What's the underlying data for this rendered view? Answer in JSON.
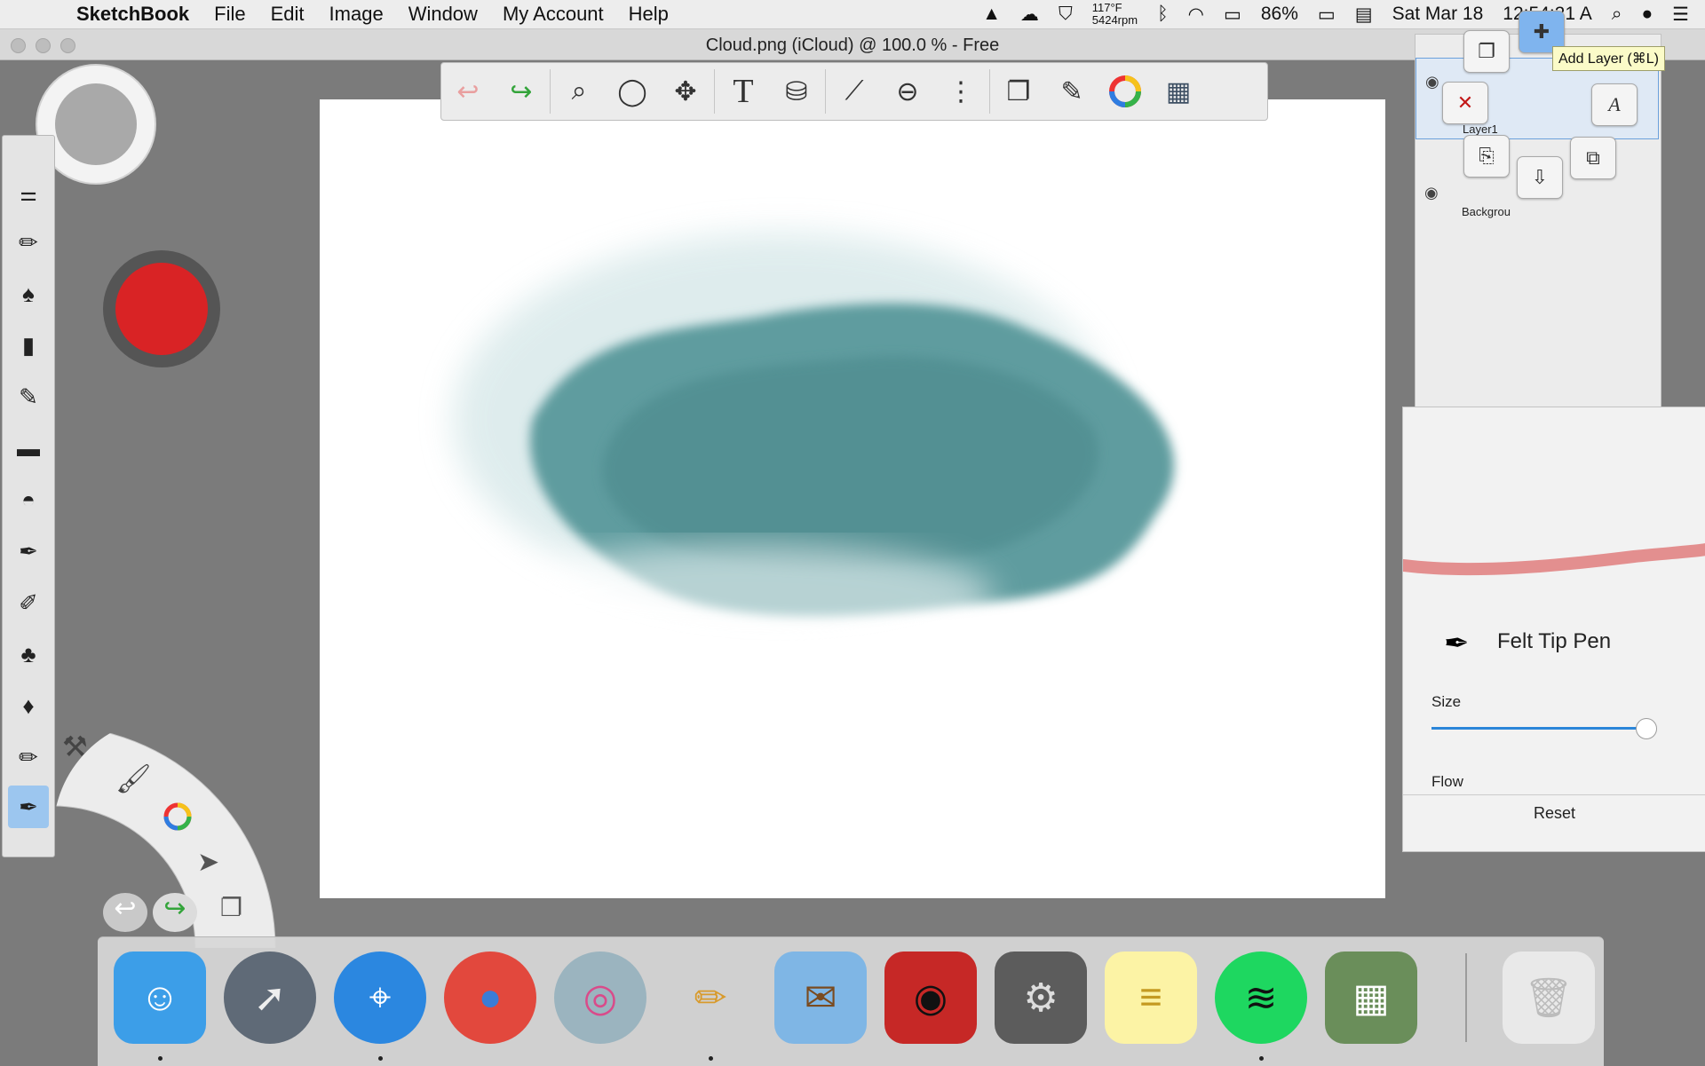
{
  "menubar": {
    "app_name": "SketchBook",
    "items": [
      "File",
      "Edit",
      "Image",
      "Window",
      "My Account",
      "Help"
    ],
    "status": {
      "temp": "117°F",
      "rpm": "5424rpm",
      "battery": "86%",
      "date": "Sat Mar 18",
      "time": "12:54:21 A"
    }
  },
  "window": {
    "title": "Cloud.png (iCloud) @ 100.0 % - Free"
  },
  "toolbar": {
    "icons": [
      "undo-icon",
      "redo-icon",
      "zoom-icon",
      "lasso-icon",
      "move-icon",
      "text-icon",
      "fill-bucket-icon",
      "ruler-icon",
      "ellipse-guide-icon",
      "symmetry-icon",
      "copy-icon",
      "brush-library-icon",
      "color-wheel-icon",
      "grid-menu-icon"
    ]
  },
  "layers": {
    "layer1_name": "Layer1",
    "background_name": "Backgrou",
    "tooltip": "Add Layer (⌘L)"
  },
  "brush": {
    "name": "Felt Tip Pen",
    "size_label": "Size",
    "flow_label": "Flow",
    "size_value": 0.97,
    "reset_label": "Reset",
    "stroke_color": "#e07e7e"
  },
  "colors": {
    "primary": "#d92325",
    "secondary": "#a9a9a9",
    "paint": "#4f8d90"
  },
  "dock": {
    "apps": [
      "finder",
      "launchpad",
      "safari",
      "chrome",
      "photo-app",
      "sketchbook",
      "mail",
      "photo-booth",
      "system-preferences",
      "notes",
      "spotify",
      "calculator",
      "trash"
    ]
  }
}
